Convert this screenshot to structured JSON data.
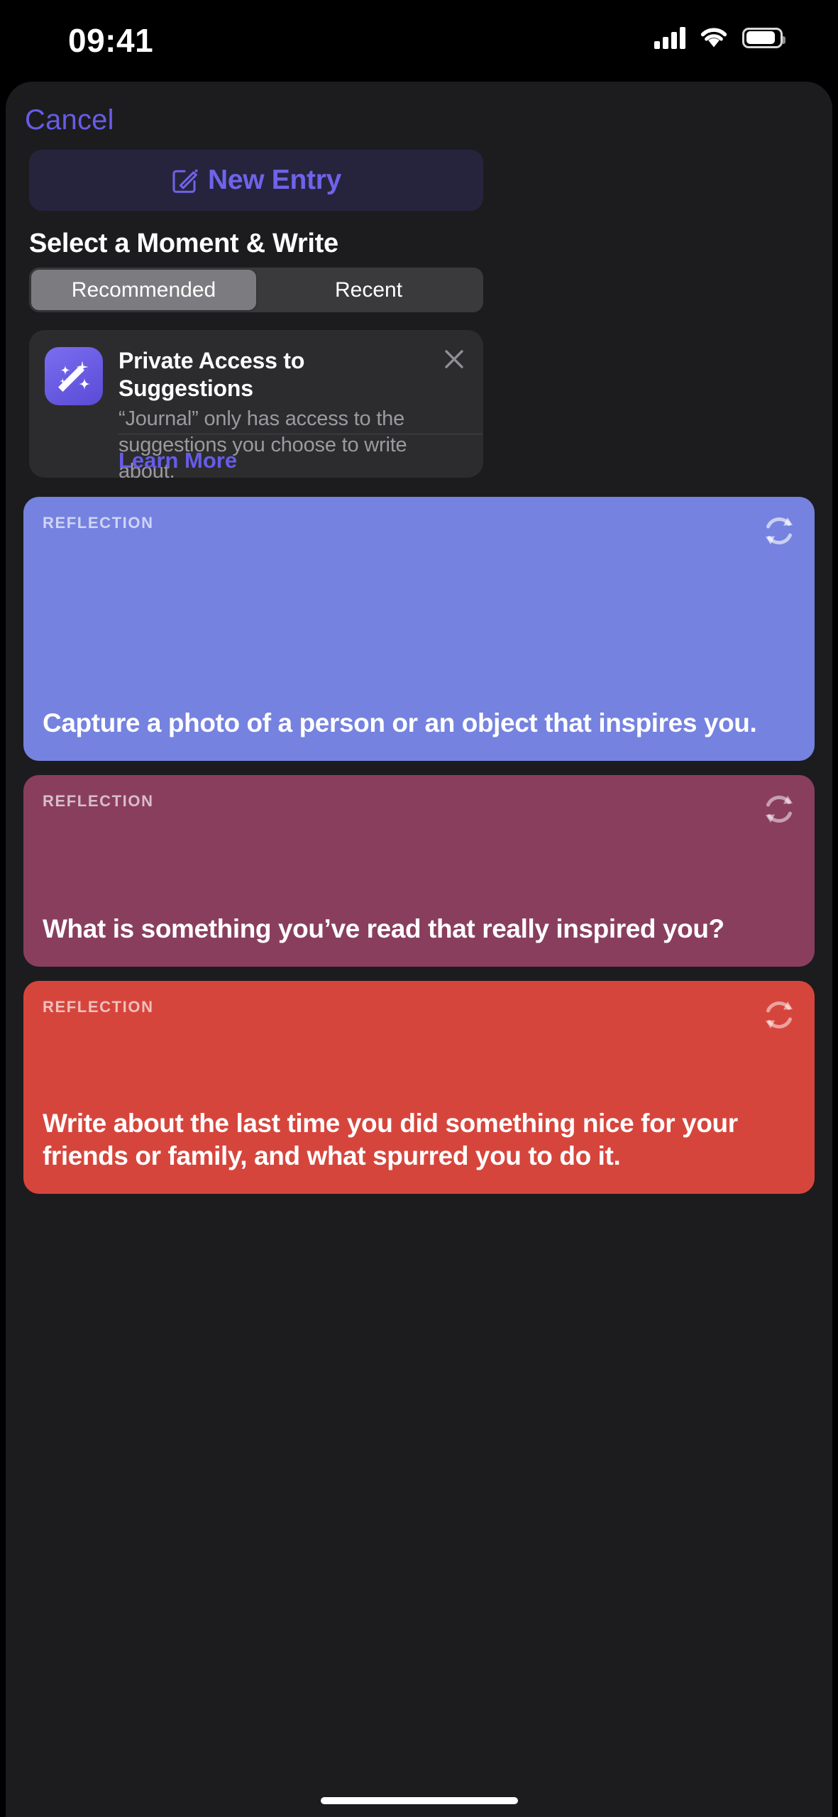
{
  "status_bar": {
    "time": "09:41",
    "signal_icon": "cellular-signal-icon",
    "wifi_icon": "wifi-icon",
    "battery_icon": "battery-icon"
  },
  "sheet": {
    "cancel_label": "Cancel",
    "new_entry": {
      "label": "New Entry",
      "icon": "compose-icon",
      "color": "#6f63ea",
      "background": "#26243d"
    },
    "section_title": "Select a Moment & Write",
    "segmented_control": {
      "options": [
        {
          "label": "Recommended",
          "selected": true
        },
        {
          "label": "Recent",
          "selected": false
        }
      ]
    },
    "info_card": {
      "icon": "magic-wand-icon",
      "title": "Private Access to Suggestions",
      "body": "“Journal” only has access to the suggestions you choose to write about.",
      "learn_more_label": "Learn More",
      "close_icon": "close-icon",
      "link_color": "#675ce8"
    },
    "suggestion_cards": [
      {
        "kicker": "REFLECTION",
        "text": "Capture a photo of a person or an object that inspires you.",
        "color": "#7582e0",
        "refresh_icon": "refresh-icon"
      },
      {
        "kicker": "REFLECTION",
        "text": "What is something you’ve read that really inspired you?",
        "color": "#8a3e5e",
        "refresh_icon": "refresh-icon"
      },
      {
        "kicker": "REFLECTION",
        "text": "Write about the last time you did something nice for your friends or family, and what spurred you to do it.",
        "color": "#d6453c",
        "refresh_icon": "refresh-icon"
      }
    ]
  }
}
